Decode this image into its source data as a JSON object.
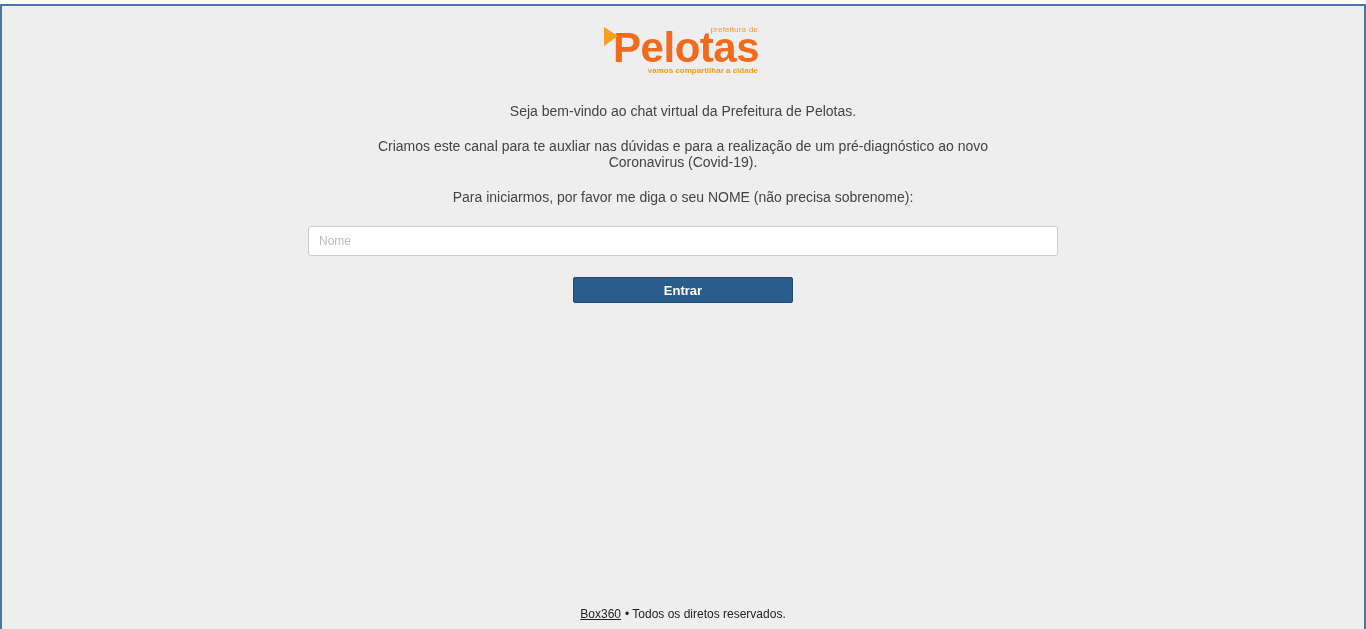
{
  "logo": {
    "pretitle": "prefeitura de",
    "name": "Pelotas",
    "tagline": "vamos compartilhar a cidade"
  },
  "messages": [
    "Seja bem-vindo ao chat virtual da Prefeitura de Pelotas.",
    "Criamos este canal para te auxliar nas dúvidas e para a realização de um pré-diagnóstico ao novo Coronavirus (Covid-19).",
    "Para iniciarmos, por favor me diga o seu NOME (não precisa sobrenome):"
  ],
  "name_field": {
    "placeholder": "Nome"
  },
  "submit_button": {
    "label": "Entrar"
  },
  "footer": {
    "link": "Box360",
    "text": "• Todos os diretos reservados."
  }
}
